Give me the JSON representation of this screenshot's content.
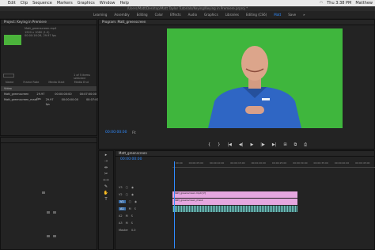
{
  "menubar": {
    "apple_icon": "apple-logo-icon",
    "items": [
      "Edit",
      "Clip",
      "Sequence",
      "Markers",
      "Graphics",
      "Window",
      "Help"
    ],
    "time": "Thu 3:38 PM",
    "user": "Matthew"
  },
  "titlebar": {
    "path": "/Users/Matt/Desktop/Matt Taylor Tutorials/Keying/Keying in Premiere.prproj *"
  },
  "workspaces": {
    "items": [
      "Learning",
      "Assembly",
      "Editing",
      "Color",
      "Effects",
      "Audio",
      "Graphics",
      "Libraries",
      "Editing (CS6)",
      "Matt",
      "Save"
    ],
    "active_index": 9,
    "more": "»"
  },
  "project_panel": {
    "tab": "Project: Keying in Premiere",
    "meta": [
      "Matt_greenscreen.mp4",
      "1920 x 1080 (1.0)",
      "00:00:16:26, 29.97 fps"
    ],
    "count": "1 of 5 items selected",
    "columns": [
      "Name",
      "Frame Rate",
      "Media Start",
      "Media End"
    ],
    "rows": [
      {
        "name": "Video",
        "rate": "",
        "start": "",
        "end": "",
        "selected": true
      },
      {
        "name": "Matt_greenscreen",
        "rate": "29.97 fps",
        "start": "00:00:00:00",
        "end": "00:07:00:00",
        "selected": false
      },
      {
        "name": "Matt_greenscreen_mask",
        "rate": "29.97 fps",
        "start": "00:00:00:00",
        "end": "00:07:00:24",
        "selected": false
      }
    ]
  },
  "program_monitor": {
    "tab": "Program: Matt_greenscreen",
    "timecode": "00:00:00:00",
    "fit": "Fit",
    "transport": [
      "{",
      "}",
      "|◀",
      "◀|",
      "▶",
      "|▶",
      "▶|",
      "⊞",
      "⧉",
      "⎙"
    ]
  },
  "timeline": {
    "tab": "Matt_greenscreen",
    "timecode": "00:00:00:00",
    "ruler": [
      "00:00",
      "00:00:05:00",
      "00:00:10:00",
      "00:00:15:00",
      "00:00:20:00",
      "00:00:25:00",
      "00:00:30:00",
      "00:00:35:00",
      "00:00:40:00",
      "00:00:45:00"
    ],
    "tracks": [
      {
        "label": "V3",
        "kind": "video"
      },
      {
        "label": "V2",
        "kind": "video"
      },
      {
        "label": "V1",
        "kind": "video"
      },
      {
        "label": "A1",
        "kind": "audio"
      },
      {
        "label": "A2",
        "kind": "audio"
      },
      {
        "label": "A3",
        "kind": "audio"
      },
      {
        "label": "Master",
        "value": "0.0"
      }
    ],
    "clips": {
      "v2": "Matt_greenscreen.mp4 [V]",
      "v1": "Matt_greenscreen_mask"
    }
  },
  "tools": [
    "▸",
    "⇢",
    "⇹",
    "✂",
    "⟷",
    "✎",
    "✋",
    "T"
  ],
  "colors": {
    "accent": "#2f8bff",
    "greenscreen": "#3fb63d",
    "clip_video": "#e5a6df",
    "clip_audio": "#72d1c1"
  }
}
